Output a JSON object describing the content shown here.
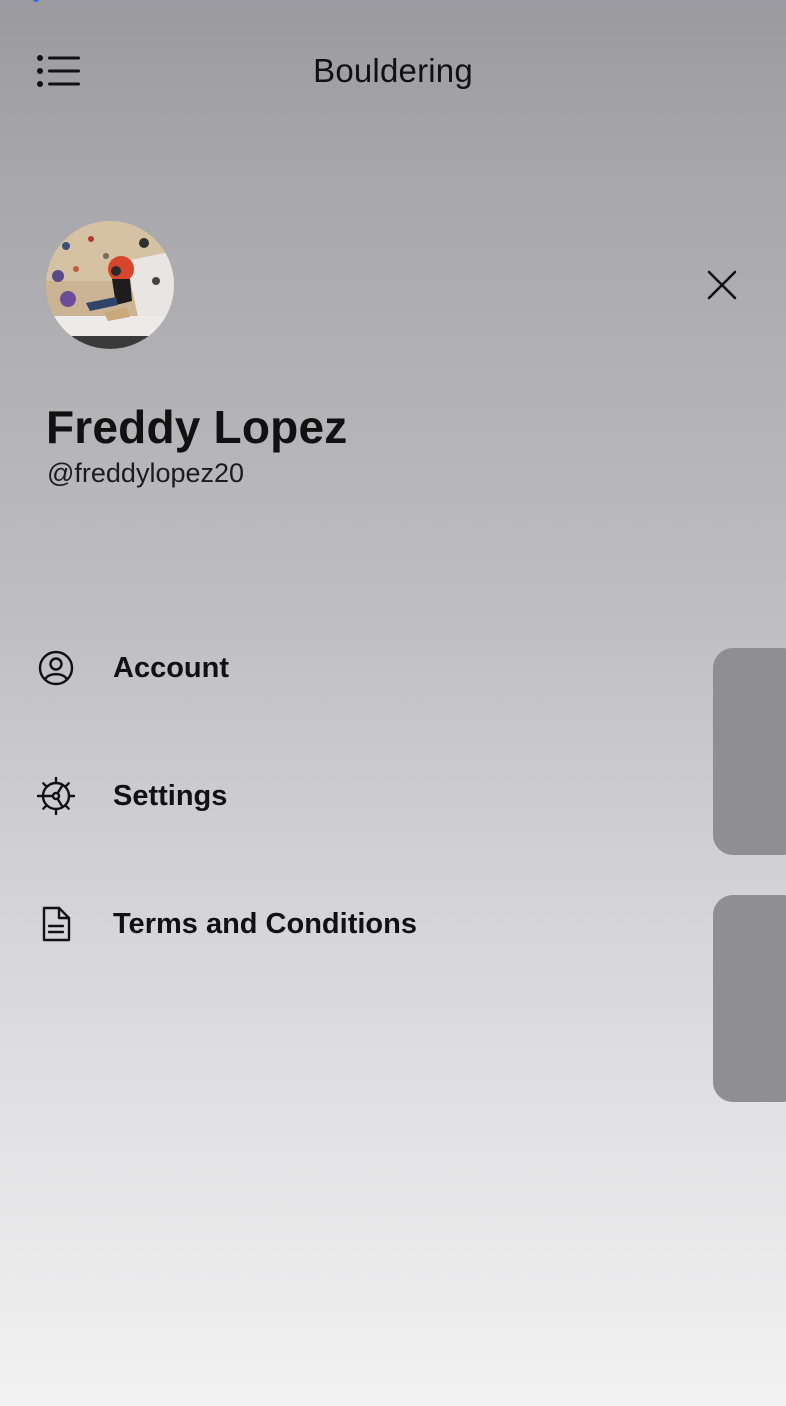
{
  "header": {
    "title": "Bouldering",
    "menu_icon": "list-bullet-icon"
  },
  "profile": {
    "name": "Freddy Lopez",
    "handle": "@freddylopez20",
    "avatar": "climber-photo"
  },
  "close_icon": "close-x-icon",
  "menu": {
    "items": [
      {
        "label": "Account",
        "icon": "person-circle-icon"
      },
      {
        "label": "Settings",
        "icon": "gear-icon"
      },
      {
        "label": "Terms and Conditions",
        "icon": "document-icon"
      }
    ]
  },
  "colors": {
    "accent": "#2f6fe0",
    "card": "#8e8e93"
  }
}
